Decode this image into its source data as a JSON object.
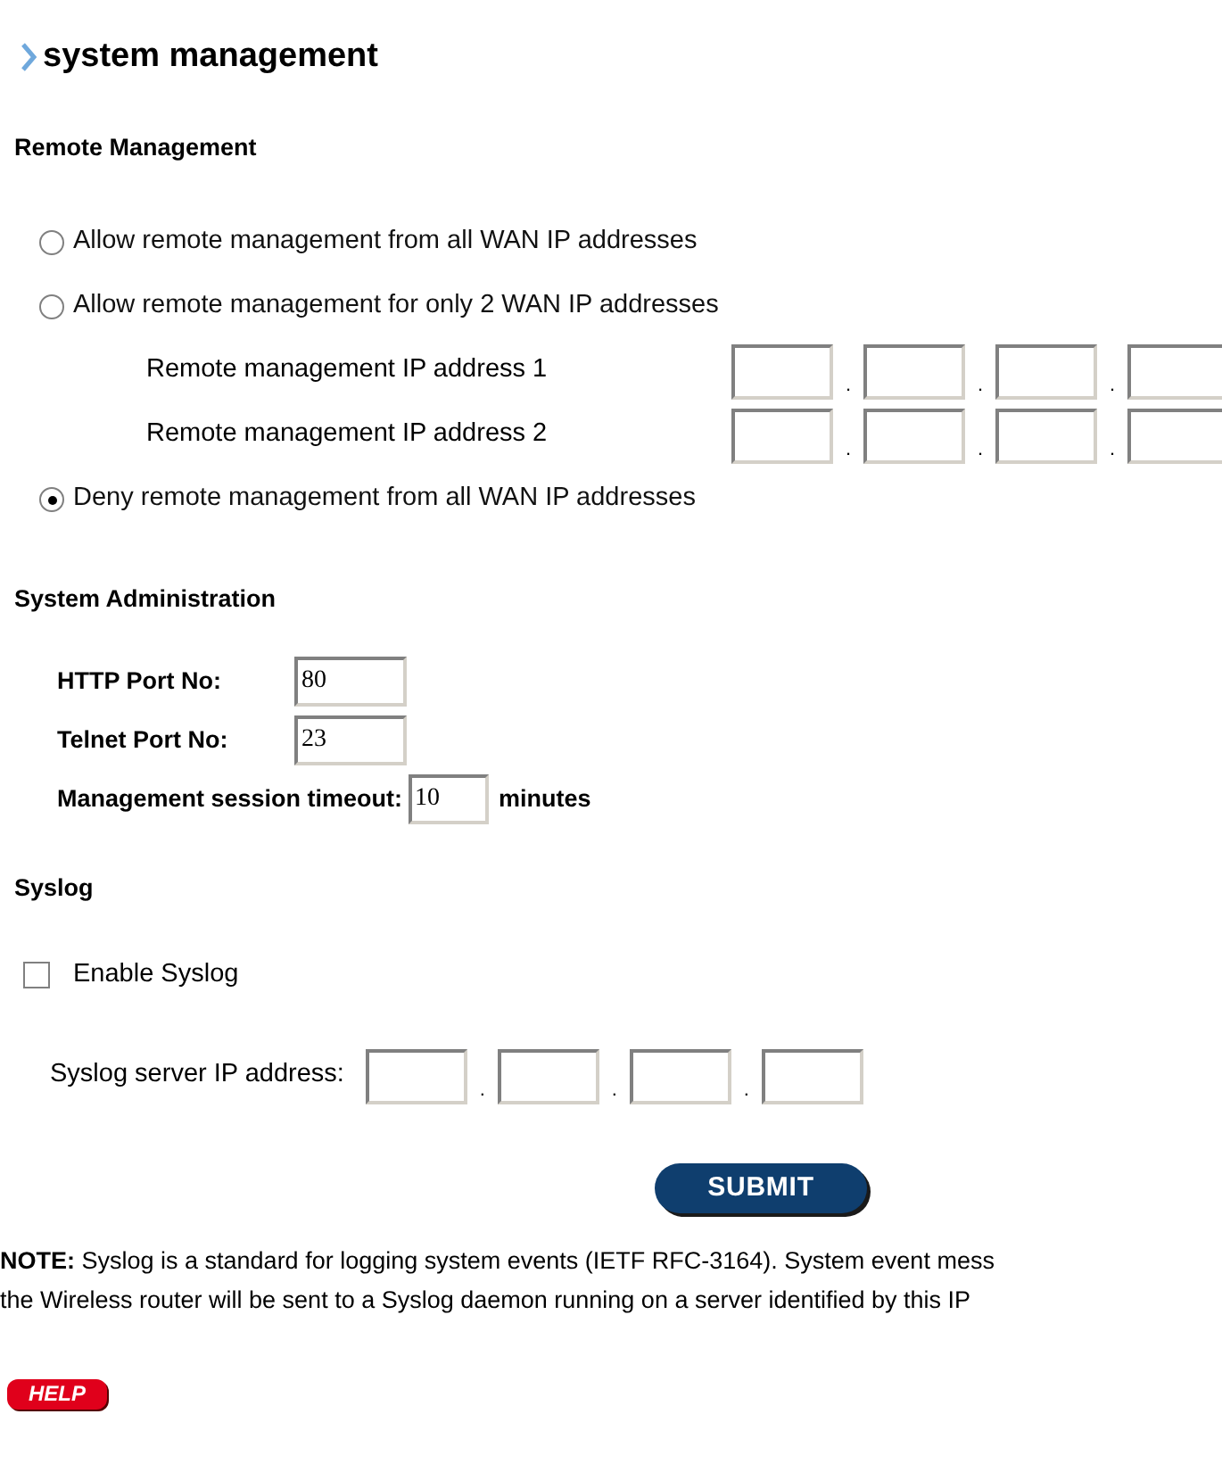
{
  "title": "system management",
  "remote_management": {
    "heading": "Remote Management",
    "items": [
      {
        "kind": "radio",
        "label": "Allow remote management from all WAN IP addresses",
        "selected": false
      },
      {
        "kind": "radio",
        "label": "Allow remote management for only 2 WAN IP addresses",
        "selected": false
      },
      {
        "kind": "ip",
        "label": "Remote management IP address 1",
        "separator": "."
      },
      {
        "kind": "ip",
        "label": "Remote management IP address 2",
        "separator": "."
      },
      {
        "kind": "radio",
        "label": "Deny remote management from all WAN IP addresses",
        "selected": true
      }
    ]
  },
  "system_administration": {
    "heading": "System Administration",
    "fields": [
      {
        "label": "HTTP Port No:",
        "value": "80"
      },
      {
        "label": "Telnet Port No:",
        "value": "23"
      },
      {
        "label": "Management session timeout:",
        "value": "10",
        "unit": "minutes"
      }
    ]
  },
  "syslog": {
    "heading": "Syslog",
    "enable": {
      "label": "Enable Syslog",
      "checked": false
    },
    "server": {
      "label": "Syslog server IP address:",
      "separator": "."
    }
  },
  "submit": "SUBMIT",
  "note": [
    "**NOTE:** Syslog is a standard for logging system events (IETF RFC-3164). System event mess",
    "the Wireless router will be sent to a Syslog daemon running on a server identified by this IP"
  ],
  "help": "HELP"
}
